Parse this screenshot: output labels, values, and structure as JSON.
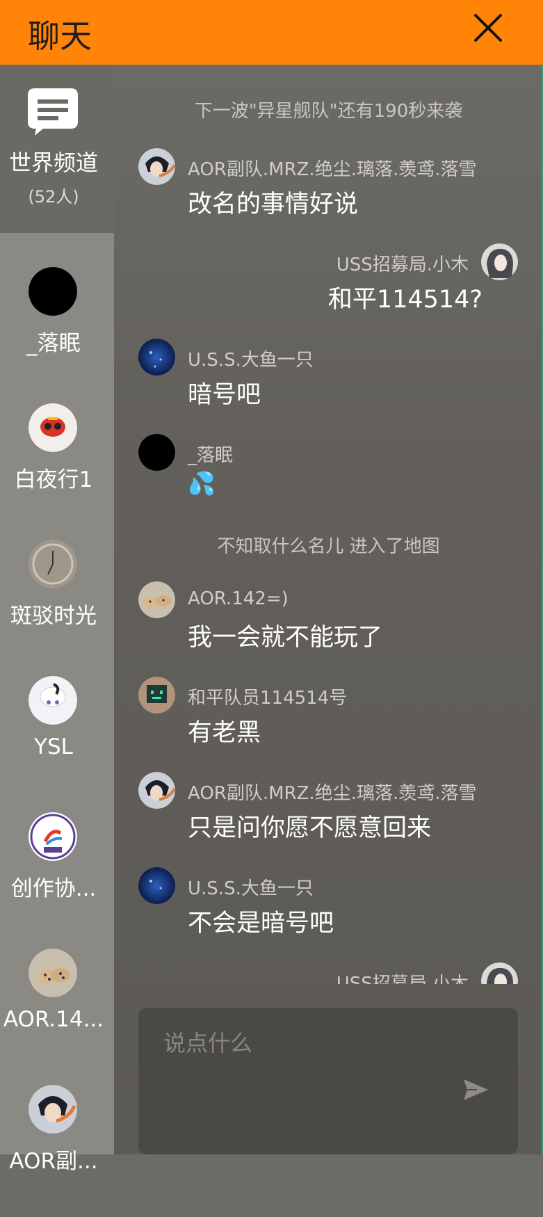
{
  "header": {
    "title": "聊天"
  },
  "sidebar": {
    "world": {
      "label": "世界频道",
      "count": "(52人)"
    },
    "contacts": [
      {
        "name": "_落眠"
      },
      {
        "name": "白夜行1"
      },
      {
        "name": "斑驳时光"
      },
      {
        "name": "YSL"
      },
      {
        "name": "创作协..."
      },
      {
        "name": "AOR.14..."
      },
      {
        "name": "AOR副..."
      }
    ]
  },
  "chat": {
    "system": [
      "下一波\"异星舰队\"还有190秒来袭",
      "不知取什么名儿 进入了地图"
    ],
    "messages": [
      {
        "sender": "AOR副队.MRZ.绝尘.璃落.羡鸢.落雪",
        "text": "改名的事情好说"
      },
      {
        "sender": "USS招募局.小木",
        "text": "和平114514?"
      },
      {
        "sender": "U.S.S.大鱼一只",
        "text": "暗号吧"
      },
      {
        "sender": "_落眠",
        "text": "💦"
      },
      {
        "sender": "AOR.142=)",
        "text": "我一会就不能玩了"
      },
      {
        "sender": "和平队员114514号",
        "text": "有老黑"
      },
      {
        "sender": "AOR副队.MRZ.绝尘.璃落.羡鸢.落雪",
        "text": "只是问你愿不愿意回来"
      },
      {
        "sender": "U.S.S.大鱼一只",
        "text": "不会是暗号吧"
      },
      {
        "sender": "USS招募局.小木",
        "text": ""
      }
    ],
    "input": {
      "placeholder": "说点什么"
    }
  },
  "colors": {
    "header": "#ff8408",
    "sidebar": "#8b8983",
    "sidebar_active": "#6b6964",
    "chat_bg": "#625f5a"
  }
}
